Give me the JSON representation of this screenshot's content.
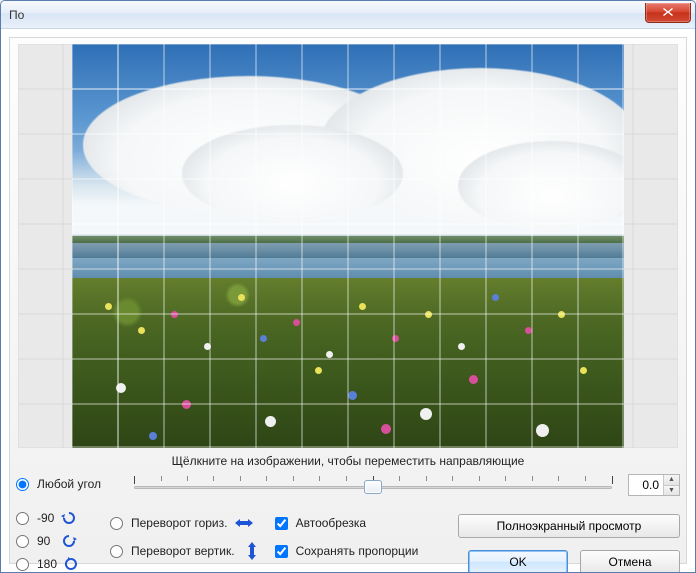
{
  "window": {
    "title": "По"
  },
  "hint": "Щёлкните на изображении, чтобы переместить направляющие",
  "angle": {
    "free_label": "Любой угол",
    "m90": "-90",
    "p90": "90",
    "p180": "180",
    "value": "0.0"
  },
  "flip": {
    "flip_h": "Переворот гориз.",
    "flip_v": "Переворот вертик."
  },
  "checks": {
    "autocrop": "Автообрезка",
    "keep_proportions": "Сохранять пропорции"
  },
  "buttons": {
    "fullscreen": "Полноэкранный просмотр",
    "ok": "OK",
    "cancel": "Отмена"
  }
}
